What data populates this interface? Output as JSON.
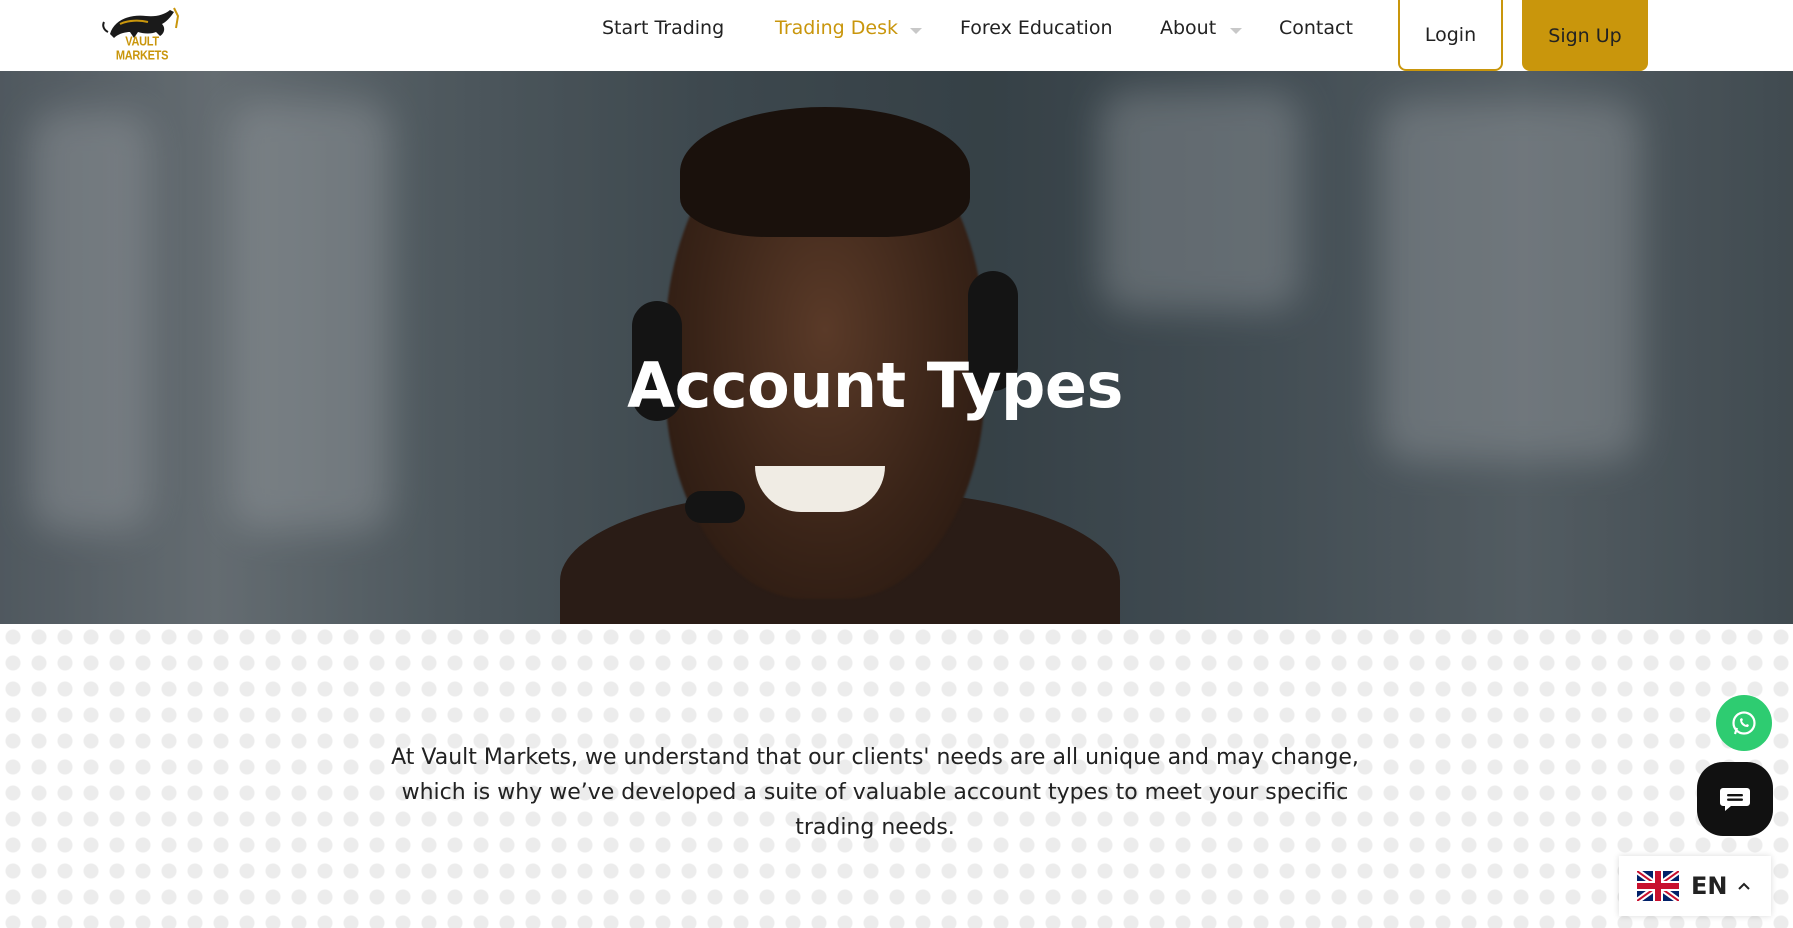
{
  "header": {
    "logo_text": "VAULT MARKETS",
    "nav": [
      {
        "label": "Start Trading",
        "has_dropdown": false,
        "active": false
      },
      {
        "label": "Trading Desk",
        "has_dropdown": true,
        "active": true
      },
      {
        "label": "Forex Education",
        "has_dropdown": false,
        "active": false
      },
      {
        "label": "About",
        "has_dropdown": true,
        "active": false
      },
      {
        "label": "Contact",
        "has_dropdown": false,
        "active": false
      }
    ],
    "login_label": "Login",
    "signup_label": "Sign Up"
  },
  "hero": {
    "title": "Account Types"
  },
  "main": {
    "intro": "At Vault Markets, we understand that our clients' needs are all unique and may change, which is why we’ve developed a suite of valuable account types to meet your specific trading needs."
  },
  "widgets": {
    "whatsapp_icon": "whatsapp-icon",
    "chat_icon": "chat-bubble-icon",
    "language": {
      "code": "EN",
      "flag_icon": "uk-flag-icon"
    }
  },
  "colors": {
    "accent": "#c9960c",
    "whatsapp": "#2ecc71",
    "chat": "#111111"
  }
}
